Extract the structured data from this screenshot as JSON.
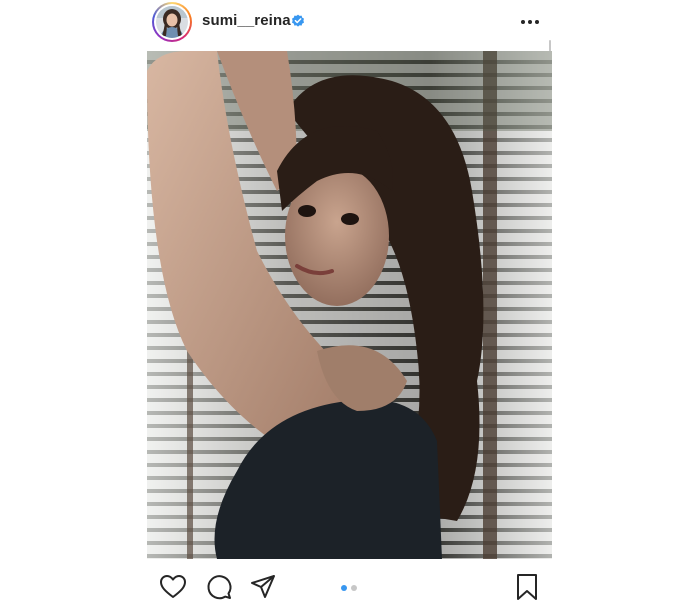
{
  "post": {
    "username": "sumi__reina",
    "verified": true,
    "header_icons": {
      "verified": "verified-badge-icon",
      "more": "more-options-icon"
    },
    "carousel": {
      "current": 1,
      "total": 2
    },
    "actions": {
      "like": "heart-icon",
      "comment": "comment-bubble-icon",
      "share": "paper-plane-icon",
      "save": "bookmark-icon"
    },
    "colors": {
      "text": "#262626",
      "verified_blue": "#3897f0",
      "dot_active": "#3897f0",
      "dot_inactive": "#c7c7c7"
    }
  }
}
